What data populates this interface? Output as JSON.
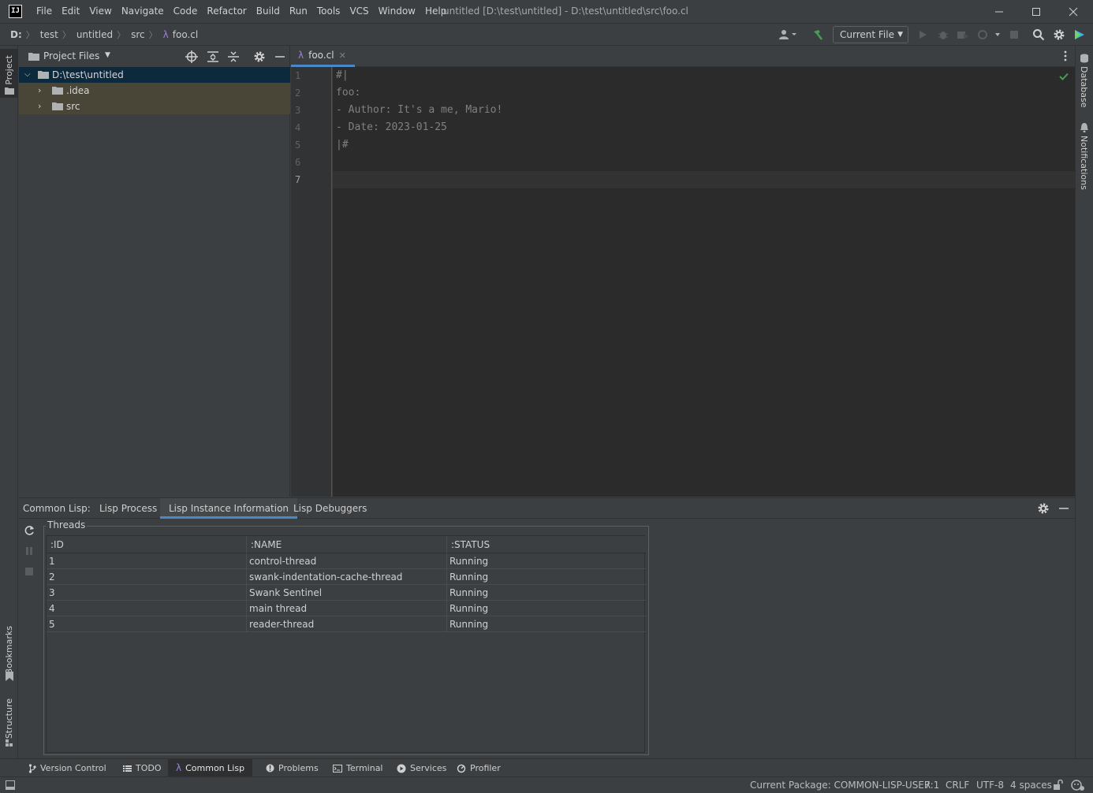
{
  "app": {
    "logo_text": "IJ",
    "menu": [
      "File",
      "Edit",
      "View",
      "Navigate",
      "Code",
      "Refactor",
      "Build",
      "Run",
      "Tools",
      "VCS",
      "Window",
      "Help"
    ],
    "window_title": "untitled [D:\\test\\untitled] - D:\\test\\untitled\\src\\foo.cl"
  },
  "navbar": {
    "breadcrumb": [
      "D:",
      "test",
      "untitled",
      "src",
      "foo.cl"
    ],
    "run_config": "Current File"
  },
  "left_stripe": {
    "project": "Project",
    "bookmarks": "Bookmarks",
    "structure": "Structure"
  },
  "right_stripe": {
    "database": "Database",
    "notifications": "Notifications"
  },
  "project_panel": {
    "title": "Project Files",
    "tree": [
      {
        "label": "D:\\test\\untitled",
        "expanded": true,
        "selected": true
      },
      {
        "label": ".idea",
        "expanded": false
      },
      {
        "label": "src",
        "expanded": false
      }
    ]
  },
  "editor": {
    "tab_label": "foo.cl",
    "line_numbers": [
      "1",
      "2",
      "3",
      "4",
      "5",
      "6",
      "7"
    ],
    "lines": [
      "#|",
      "foo:",
      "- Author: It's a me, Mario!",
      "- Date: 2023-01-25",
      "|#",
      "",
      ""
    ],
    "current_line": 7
  },
  "tool_window": {
    "prefix": "Common Lisp:",
    "tabs": [
      "Lisp Process",
      "Lisp Instance Information",
      "Lisp Debuggers"
    ],
    "active_tab": "Lisp Instance Information",
    "threads_label": "Threads",
    "columns": [
      ":ID",
      ":NAME",
      ":STATUS"
    ],
    "rows": [
      [
        "1",
        "control-thread",
        "Running"
      ],
      [
        "2",
        "swank-indentation-cache-thread",
        "Running"
      ],
      [
        "3",
        "Swank Sentinel",
        "Running"
      ],
      [
        "4",
        "main thread",
        "Running"
      ],
      [
        "5",
        "reader-thread",
        "Running"
      ]
    ]
  },
  "bottom_tabs": [
    "Version Control",
    "TODO",
    "Common Lisp",
    "Problems",
    "Terminal",
    "Services",
    "Profiler"
  ],
  "status": {
    "package": "Current Package: COMMON-LISP-USER",
    "position": "7:1",
    "line_sep": "CRLF",
    "encoding": "UTF-8",
    "indent": "4 spaces"
  },
  "colors": {
    "background": "#3c3f41",
    "editor_bg": "#2b2b2b",
    "accent": "#4a88c7",
    "lambda": "#9b7ee0",
    "check": "#499c54"
  }
}
